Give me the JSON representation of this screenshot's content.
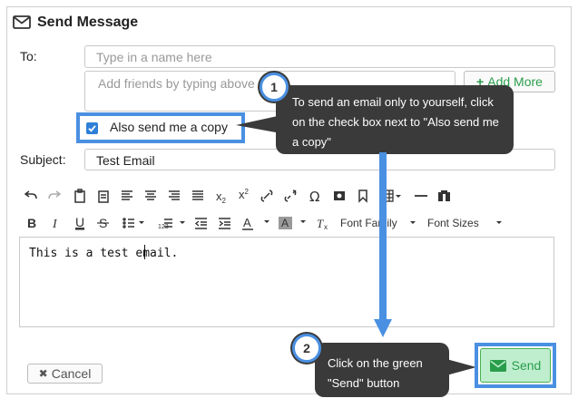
{
  "dialog": {
    "title": "Send Message",
    "to_label": "To:",
    "to_placeholder": "Type in a name here",
    "friends_placeholder": "Add friends by typing above",
    "add_more_label": "Add More",
    "copy_label": "Also send me a copy",
    "copy_checked": true,
    "subject_label": "Subject:",
    "subject_value": "Test Email",
    "body_text": "This is a test email.",
    "cancel_label": "Cancel",
    "send_label": "Send",
    "font_family_label": "Font Family",
    "font_sizes_label": "Font Sizes"
  },
  "callouts": [
    {
      "number": "1",
      "text": "To send an email only to yourself, click on the check box next to \"Also send me a copy\""
    },
    {
      "number": "2",
      "text": "Click on the green \"Send\" button"
    }
  ],
  "toolbar_row1": [
    "undo-icon",
    "redo-icon",
    "paste-icon",
    "paste-text-icon",
    "align-left-icon",
    "align-center-icon",
    "align-right-icon",
    "justify-icon",
    "subscript-icon",
    "superscript-icon",
    "link-icon",
    "unlink-icon",
    "special-char-icon",
    "image-icon",
    "bookmark-icon",
    "table-icon",
    "horizontal-rule-icon",
    "find-icon"
  ],
  "toolbar_row2": [
    "bold-icon",
    "italic-icon",
    "underline-icon",
    "strikethrough-icon",
    "bullet-list-icon",
    "numbered-list-icon",
    "outdent-icon",
    "indent-icon",
    "text-color-icon",
    "background-color-icon",
    "clear-format-icon"
  ],
  "colors": {
    "accent_blue": "#4a90e2",
    "send_green": "#4caf50",
    "send_bg": "#bfeecf",
    "add_more_green": "#2a9d4b",
    "callout_bg": "#3a3a3a"
  }
}
